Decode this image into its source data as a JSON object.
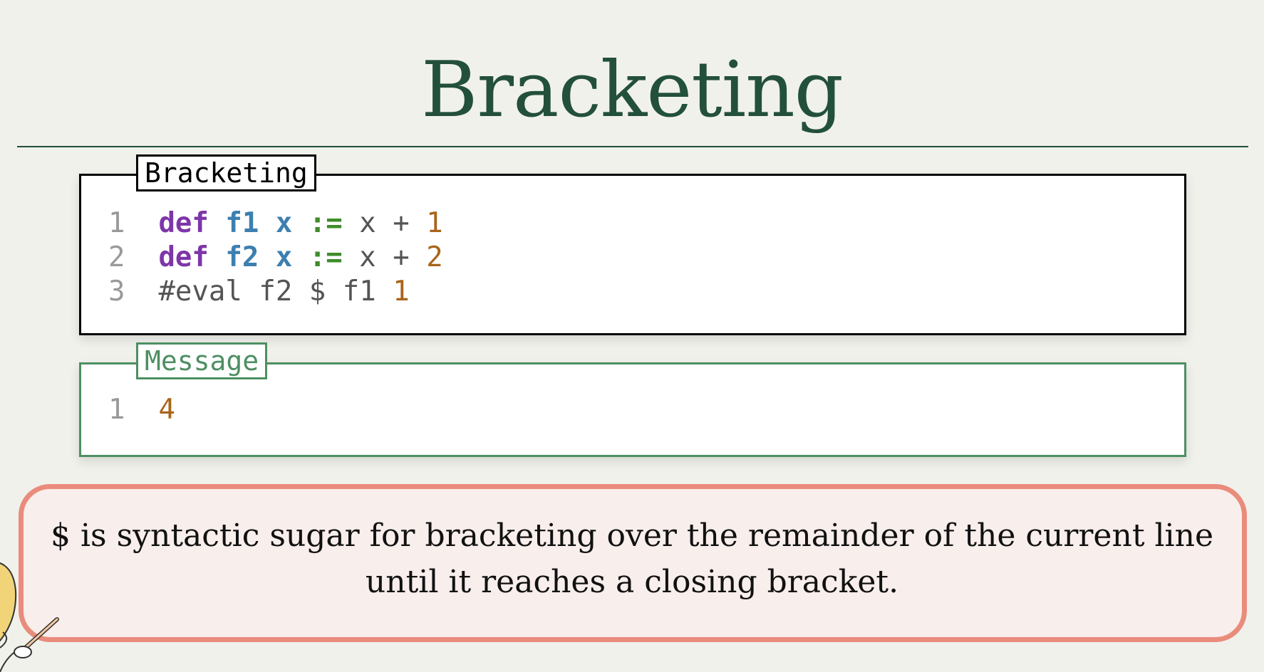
{
  "slide": {
    "title": "Bracketing"
  },
  "code_panel": {
    "label": "Bracketing",
    "lines": [
      {
        "number": "1",
        "tokens": [
          "def",
          " ",
          "f1",
          " ",
          "x",
          " ",
          ":=",
          " x + ",
          "1"
        ]
      },
      {
        "number": "2",
        "tokens": [
          "def",
          " ",
          "f2",
          " ",
          "x",
          " ",
          ":=",
          " x + ",
          "2"
        ]
      },
      {
        "number": "3",
        "tokens": [
          "#eval f2 $ f1 ",
          "1"
        ]
      }
    ]
  },
  "message_panel": {
    "label": "Message",
    "lines": [
      {
        "number": "1",
        "value": "4"
      }
    ]
  },
  "callout": {
    "line1": "$ is syntactic sugar for bracketing over the remainder of the current line",
    "line2": "until it reaches a closing bracket."
  },
  "colors": {
    "title": "#23503a",
    "keyword": "#7d36a8",
    "function": "#3d7fb0",
    "operator": "#3f8c2a",
    "number": "#a8641a",
    "message_border": "#4e8f63",
    "callout_border": "#e98c7c",
    "callout_bg": "#f8eeec"
  },
  "icons": {
    "mascot": "pointer-mascot-icon"
  }
}
